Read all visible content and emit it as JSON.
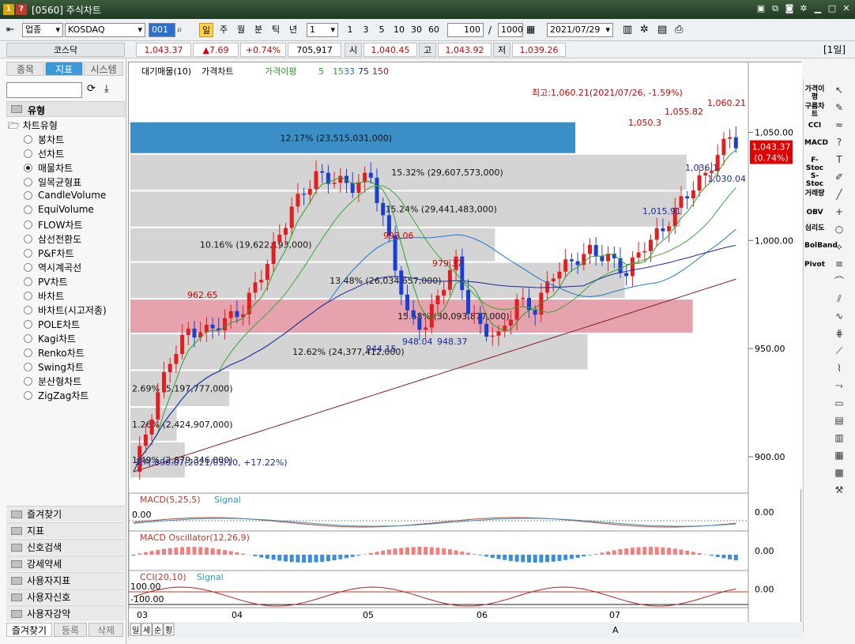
{
  "window": {
    "badge1": "1",
    "badge2": "?",
    "title": "[0560] 주식차트"
  },
  "toolbar": {
    "sector": "업종",
    "market": "KOSDAQ",
    "code": "001",
    "periods": [
      "일",
      "주",
      "월",
      "분",
      "틱",
      "년"
    ],
    "interval": "1",
    "intervals": [
      "1",
      "3",
      "5",
      "10",
      "30",
      "60"
    ],
    "count": "100",
    "slash": "/",
    "total": "1000",
    "date": "2021/07/29",
    "right_label": "[1일]"
  },
  "quote": {
    "name": "코스닥",
    "price": "1,043.37",
    "change": "▲7.69",
    "pct": "+0.74%",
    "volume": "705,917",
    "open_label": "시",
    "open": "1,040.45",
    "high_label": "고",
    "high": "1,043.92",
    "low_label": "저",
    "low": "1,039.26"
  },
  "sidebar": {
    "tabs": [
      "종목",
      "지표",
      "시스템"
    ],
    "group": "유형",
    "subgroup": "차트유형",
    "items": [
      "봉차트",
      "선차트",
      "매물차트",
      "일목균형표",
      "CandleVolume",
      "EquiVolume",
      "FLOW차트",
      "삼선전환도",
      "P&F차트",
      "역시계곡선",
      "PV차트",
      "바차트",
      "바차트(시고저종)",
      "POLE차트",
      "Kagi차트",
      "Renko차트",
      "Swing차트",
      "분산형차트",
      "ZigZag차트"
    ],
    "selected_index": 2,
    "bottom": [
      "즐겨찾기",
      "지표",
      "신호검색",
      "강세약세",
      "사용자지표",
      "사용자신호",
      "사용자강약"
    ],
    "bottom_tabs": [
      "즐겨찾기",
      "등록",
      "삭제"
    ]
  },
  "legend": {
    "items": [
      "대기매물(10)",
      "가격차트",
      "가격이평",
      "5",
      "15",
      "33",
      "75",
      "150"
    ],
    "colors": {
      "ma5": "#2e9e2e",
      "ma15": "#3aa83a",
      "ma33": "#1e78c8",
      "ma75": "#1a2a9c",
      "ma150": "#8c1a2a"
    }
  },
  "chart_data": [
    {
      "type": "candlestick+volume-profile",
      "y_ticks": [
        "1,050.00",
        "1,000.00",
        "950.00",
        "900.00"
      ],
      "ylim": [
        885,
        1075
      ],
      "x_ticks": [
        "03",
        "04",
        "05",
        "06",
        "07"
      ],
      "current_price_tag": "1,043.37",
      "current_pct_tag": "(0.74%)",
      "high_annotation": "최고:1,060.21(2021/07/26, -1.59%)",
      "low_annotation": "최저:890.07(2021/03/10, +17.22%)",
      "price_labels": [
        "962.65",
        "993.06",
        "979.37",
        "944.15",
        "948.04",
        "948.37",
        "1,050.3",
        "1,055.82",
        "1,060.21",
        "1,036.1",
        "1,030.04",
        "1,015.91"
      ],
      "volume_profile": [
        {
          "label": "12.17% (23,515,031,000)",
          "from": 1040,
          "to": 1055,
          "width": 0.72,
          "highlight": "blue"
        },
        {
          "label": "15.32% (29,607,573,000)",
          "from": 1023,
          "to": 1040,
          "width": 0.9
        },
        {
          "label": "15.24% (29,441,483,000)",
          "from": 1006,
          "to": 1023,
          "width": 0.89
        },
        {
          "label": "10.16% (19,622,193,000)",
          "from": 990,
          "to": 1006,
          "width": 0.59
        },
        {
          "label": "13.48% (26,034,657,000)",
          "from": 973,
          "to": 990,
          "width": 0.8
        },
        {
          "label": "15.58% (30,093,877,000)",
          "from": 957,
          "to": 973,
          "width": 0.91,
          "highlight": "red"
        },
        {
          "label": "12.62% (24,377,412,000)",
          "from": 940,
          "to": 957,
          "width": 0.74
        },
        {
          "label": "2.69% (5,197,777,000)",
          "from": 923,
          "to": 940,
          "width": 0.16
        },
        {
          "label": "1.26% (2,424,907,000)",
          "from": 907,
          "to": 923,
          "width": 0.075
        },
        {
          "label": "1.49% (2,879,346,000)",
          "from": 890,
          "to": 907,
          "width": 0.088
        }
      ]
    },
    {
      "type": "line",
      "title": "MACD(5,25,5)",
      "signal": "Signal",
      "zero": "0.00",
      "axis_label": "0.00"
    },
    {
      "type": "bar",
      "title": "MACD Oscillator(12,26,9)",
      "axis_label": "0.00"
    },
    {
      "type": "line",
      "title": "CCI(20,10)",
      "signal": "Signal",
      "upper": "100.00",
      "lower": "-100.00",
      "axis_label": "0.00"
    }
  ],
  "right_tools": [
    "가격이평",
    "구름차트",
    "CCI",
    "MACD",
    "F-Stoc",
    "S-Stoc",
    "거래량",
    "OBV",
    "심리도",
    "BolBand",
    "Pivot"
  ],
  "bottom_bar": {
    "buttons": [
      "일",
      "세",
      "순",
      "횡"
    ],
    "zoom_label": "A"
  }
}
